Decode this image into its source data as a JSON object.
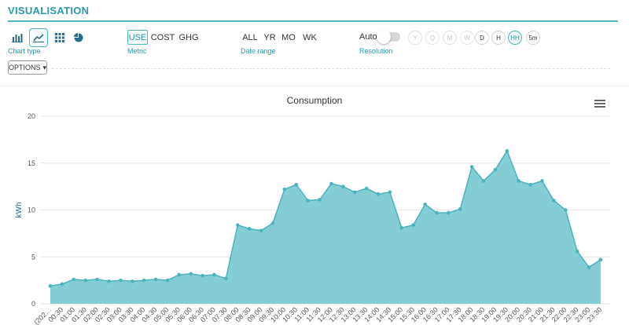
{
  "header": {
    "title": "VISUALISATION"
  },
  "chart_type": {
    "label": "Chart type",
    "buttons": [
      {
        "icon": "bar-chart-icon",
        "active": false
      },
      {
        "icon": "line-chart-icon",
        "active": true
      },
      {
        "icon": "grid-icon",
        "active": false
      },
      {
        "icon": "pie-chart-icon",
        "active": false
      }
    ]
  },
  "metric": {
    "label": "Metric",
    "options": [
      {
        "label": "USE",
        "active": true
      },
      {
        "label": "COST",
        "active": false
      },
      {
        "label": "GHG",
        "active": false
      }
    ]
  },
  "date_range": {
    "label": "Date range",
    "options": [
      {
        "label": "ALL"
      },
      {
        "label": "YR"
      },
      {
        "label": "MO"
      },
      {
        "label": "WK"
      }
    ]
  },
  "resolution": {
    "label": "Resolution",
    "auto_label": "Auto",
    "auto_on": false,
    "options": [
      {
        "label": "Y",
        "state": "disabled"
      },
      {
        "label": "Q",
        "state": "disabled"
      },
      {
        "label": "M",
        "state": "disabled"
      },
      {
        "label": "W",
        "state": "disabled"
      },
      {
        "label": "D",
        "state": "normal"
      },
      {
        "label": "H",
        "state": "normal"
      },
      {
        "label": "HH",
        "state": "active"
      },
      {
        "label": "5m",
        "state": "normal"
      }
    ]
  },
  "options_button": {
    "label": "OPTIONS",
    "caret": "▾"
  },
  "colors": {
    "accent": "#2a9aab",
    "area_fill": "#7dcbd1",
    "line": "#4ab3bd",
    "grid": "#e6e6e6"
  },
  "chart_data": {
    "type": "area",
    "title": "Consumption",
    "ylabel": "kWh",
    "xlabel": "",
    "ylim": [
      0,
      20
    ],
    "yticks": [
      0,
      5,
      10,
      15,
      20
    ],
    "grid": true,
    "legend": "none",
    "x": [
      "(202…",
      "00:30",
      "01:00",
      "01:30",
      "02:00",
      "02:30",
      "03:00",
      "03:30",
      "04:00",
      "04:30",
      "05:00",
      "05:30",
      "06:00",
      "06:30",
      "07:00",
      "07:30",
      "08:00",
      "08:30",
      "09:00",
      "09:30",
      "10:00",
      "10:30",
      "11:00",
      "11:30",
      "12:00",
      "12:30",
      "13:00",
      "13:30",
      "14:00",
      "14:30",
      "15:00",
      "15:30",
      "16:00",
      "16:30",
      "17:00",
      "17:30",
      "18:00",
      "18:30",
      "19:00",
      "19:30",
      "20:00",
      "20:30",
      "21:00",
      "21:30",
      "22:00",
      "22:30",
      "23:00",
      "23:30"
    ],
    "series": [
      {
        "values": [
          1.9,
          2.1,
          2.6,
          2.5,
          2.6,
          2.4,
          2.5,
          2.4,
          2.5,
          2.6,
          2.5,
          3.1,
          3.2,
          3.0,
          3.1,
          2.7,
          8.4,
          8.0,
          7.8,
          8.6,
          12.2,
          12.7,
          11.0,
          11.1,
          12.8,
          12.5,
          11.9,
          12.3,
          11.7,
          11.9,
          8.1,
          8.4,
          10.6,
          9.7,
          9.7,
          10.1,
          14.6,
          13.1,
          14.3,
          16.3,
          13.1,
          12.7,
          13.1,
          11.0,
          10.0,
          5.6,
          3.9,
          4.7
        ]
      }
    ]
  }
}
